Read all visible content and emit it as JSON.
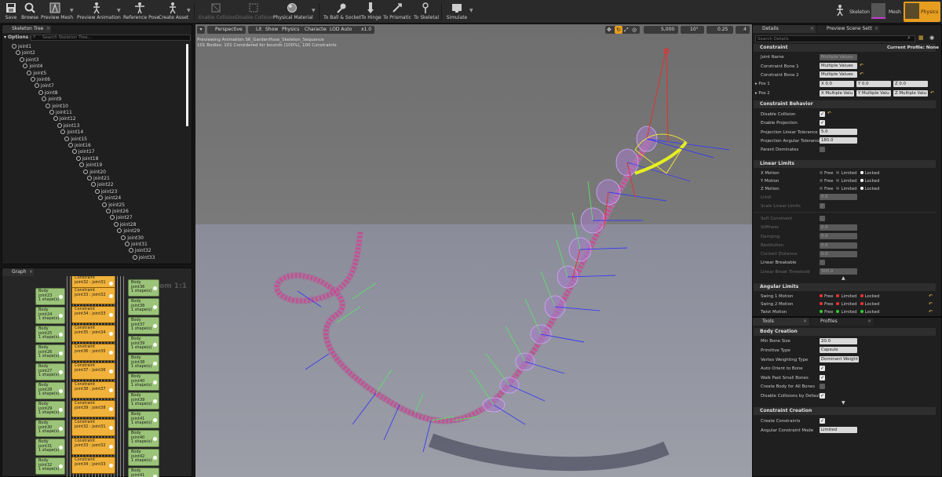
{
  "toolbar": {
    "items": [
      {
        "label": "Save",
        "icon": "save-icon"
      },
      {
        "label": "Browse",
        "icon": "browse-icon"
      },
      {
        "label": "Preview Mesh",
        "icon": "preview-mesh-icon"
      },
      {
        "label": "Preview Animation",
        "icon": "preview-animation-icon"
      },
      {
        "label": "Reference Pose",
        "icon": "reference-pose-icon"
      },
      {
        "label": "Create Asset",
        "icon": "create-asset-icon"
      },
      {
        "label": "Enable Collision",
        "icon": "enable-collision-icon"
      },
      {
        "label": "Disable Collision",
        "icon": "disable-collision-icon"
      },
      {
        "label": "Physical Material",
        "icon": "physical-material-icon"
      },
      {
        "label": "To Ball & Socket",
        "icon": "ball-socket-icon"
      },
      {
        "label": "To Hinge",
        "icon": "hinge-icon"
      },
      {
        "label": "To Prismatic",
        "icon": "prismatic-icon"
      },
      {
        "label": "To Skeletal",
        "icon": "skeletal-icon"
      },
      {
        "label": "Simulate",
        "icon": "simulate-icon"
      }
    ],
    "modes": [
      {
        "label": "Skeleton"
      },
      {
        "label": "Mesh"
      },
      {
        "label": "Physics"
      }
    ]
  },
  "skeleton_tree": {
    "tab_label": "Skeleton Tree",
    "options_label": "Options",
    "search_placeholder": "Search Skeleton Tree...",
    "joints": [
      "joint1",
      "joint2",
      "joint3",
      "joint4",
      "joint5",
      "joint6",
      "joint7",
      "joint8",
      "joint9",
      "joint10",
      "joint11",
      "joint12",
      "joint13",
      "joint14",
      "joint15",
      "joint16",
      "joint17",
      "joint18",
      "joint19",
      "joint20",
      "joint21",
      "joint22",
      "joint23",
      "joint24",
      "joint25",
      "joint26",
      "joint27",
      "joint28",
      "joint29",
      "joint30",
      "joint31",
      "joint32",
      "joint33"
    ]
  },
  "graph": {
    "tab_label": "Graph",
    "zoom": "Zoom 1:1",
    "shape_text": "1 shape(s)",
    "body_label": "Body",
    "constraint_label": "Constraint",
    "left_bodies": [
      "joint23",
      "joint24",
      "joint25",
      "joint26",
      "joint27",
      "joint28",
      "joint29",
      "joint30",
      "joint31",
      "joint32"
    ],
    "constraints": [
      "joint33 : joint32",
      "joint34 : joint33",
      "joint35 : joint34",
      "joint36 : joint35",
      "joint37 : joint36",
      "joint38 : joint37",
      "joint39 : joint38",
      "joint32 : joint31",
      "joint33 : joint32",
      "joint34 : joint33",
      "joint35 : joint34",
      "joint36 : joint35",
      "joint37 : joint36",
      "joint38 : joint37",
      "joint39 : joint38"
    ],
    "right_bodies": [
      "joint38",
      "joint37",
      "joint39",
      "joint38",
      "joint40",
      "joint39",
      "joint41",
      "joint40",
      "joint42",
      "joint41"
    ],
    "top_right_body": "joint36",
    "top_constraint": "joint32 : joint31"
  },
  "viewport": {
    "perspective": "Perspective",
    "lit": "Lit",
    "show": "Show",
    "physics": "Physics",
    "character": "Character",
    "lod": "LOD Auto",
    "speed": "x1.0",
    "grid_snap": "5,000",
    "rot_snap": "10°",
    "scale_snap": "0.25",
    "camera_speed": "4",
    "info_line1": "Previewing Animation SK_GardenHose_Skeleton_Sequence",
    "info_line2": "101 Bodies: 101 Considered for bounds (100%), 100 Constraints"
  },
  "details": {
    "tab_label": "Details",
    "tab2_label": "Preview Scene Sett",
    "search_placeholder": "Search Details",
    "constraint_header": "Constraint",
    "current_profile": "Current Profile: None",
    "joint_name_label": "Joint Name",
    "joint_name_value": "Multiple Values",
    "bone1_label": "Constraint Bone 1",
    "bone1_value": "Multiple Values",
    "bone2_label": "Constraint Bone 2",
    "bone2_value": "Multiple Values",
    "pos1_label": "Pos 1",
    "pos1": {
      "x": "X 0.0",
      "y": "Y 0.0",
      "z": "Z 0.0"
    },
    "pos2_label": "Pos 2",
    "pos2": {
      "x": "X Multiple Valu",
      "y": "Y Multiple Valu",
      "z": "Z Multiple Valu"
    },
    "behavior_header": "Constraint Behavior",
    "disable_collision": "Disable Collision",
    "enable_projection": "Enable Projection",
    "proj_linear_label": "Projection Linear Tolerance",
    "proj_linear_value": "5.0",
    "proj_angular_label": "Projection Angular Tolerance",
    "proj_angular_value": "180.0",
    "parent_dominates": "Parent Dominates",
    "linear_header": "Linear Limits",
    "x_motion": "X Motion",
    "y_motion": "Y Motion",
    "z_motion": "Z Motion",
    "free": "Free",
    "limited": "Limited",
    "locked": "Locked",
    "limit_label": "Limit",
    "limit_value": "0.0",
    "scale_linear": "Scale Linear Limits",
    "soft_constraint": "Soft Constraint",
    "stiffness_label": "Stiffness",
    "stiffness_value": "0.0",
    "damping_label": "Damping",
    "damping_value": "0.0",
    "restitution_label": "Restitution",
    "restitution_value": "0.0",
    "contact_distance_label": "Contact Distance",
    "contact_distance_value": "0.0",
    "linear_breakable": "Linear Breakable",
    "linear_break_label": "Linear Break Threshold",
    "linear_break_value": "300.0",
    "angular_header": "Angular Limits",
    "swing1": "Swing 1 Motion",
    "swing2": "Swing 2 Motion",
    "twist": "Twist Motion"
  },
  "tools": {
    "tab_label": "Tools",
    "tab2_label": "Profiles",
    "body_creation_header": "Body Creation",
    "min_bone_label": "Min Bone Size",
    "min_bone_value": "20.0",
    "primitive_label": "Primitive Type",
    "primitive_value": "Capsule",
    "vertex_label": "Vertex Weighting Type",
    "vertex_value": "Dominant Weight",
    "auto_orient": "Auto Orient to Bone",
    "walk_past": "Walk Past Small Bones",
    "create_body_all": "Create Body for All Bones",
    "disable_collisions_default": "Disable Collisions by Default",
    "constraint_creation_header": "Constraint Creation",
    "create_constraints": "Create Constraints",
    "angular_mode_label": "Angular Constraint Mode",
    "angular_mode_value": "Limited"
  },
  "colors": {
    "accent": "#f0a028",
    "body_node": "#9bc479",
    "constraint_node": "#f0b23a",
    "viewport_sky": "#737373",
    "viewport_floor": "#8c8fa0"
  }
}
